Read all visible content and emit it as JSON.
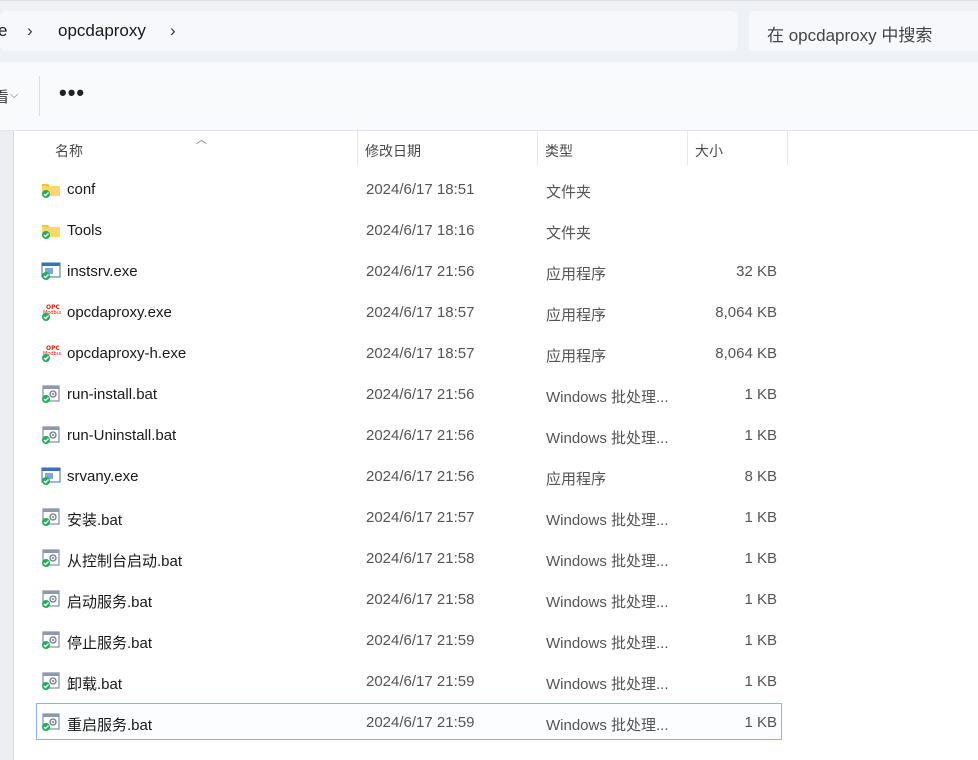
{
  "address": {
    "prev_crumb": "e",
    "separator": "›",
    "current": "opcdaproxy",
    "search_placeholder": "在 opcdaproxy 中搜索"
  },
  "toolbar": {
    "partial_label": "看",
    "more_label": "•••"
  },
  "columns": {
    "name": "名称",
    "date": "修改日期",
    "type": "类型",
    "size": "大小"
  },
  "files": [
    {
      "name": "conf",
      "date": "2024/6/17 18:51",
      "type": "文件夹",
      "size": "",
      "icon": "folder-icon"
    },
    {
      "name": "Tools",
      "date": "2024/6/17 18:16",
      "type": "文件夹",
      "size": "",
      "icon": "folder-icon"
    },
    {
      "name": "instsrv.exe",
      "date": "2024/6/17 21:56",
      "type": "应用程序",
      "size": "32 KB",
      "icon": "app-icon"
    },
    {
      "name": "opcdaproxy.exe",
      "date": "2024/6/17 18:57",
      "type": "应用程序",
      "size": "8,064 KB",
      "icon": "opc-app-icon"
    },
    {
      "name": "opcdaproxy-h.exe",
      "date": "2024/6/17 18:57",
      "type": "应用程序",
      "size": "8,064 KB",
      "icon": "opc-app-icon"
    },
    {
      "name": "run-install.bat",
      "date": "2024/6/17 21:56",
      "type": "Windows 批处理...",
      "size": "1 KB",
      "icon": "batch-file-icon"
    },
    {
      "name": "run-Uninstall.bat",
      "date": "2024/6/17 21:56",
      "type": "Windows 批处理...",
      "size": "1 KB",
      "icon": "batch-file-icon"
    },
    {
      "name": "srvany.exe",
      "date": "2024/6/17 21:56",
      "type": "应用程序",
      "size": "8 KB",
      "icon": "app-icon"
    },
    {
      "name": "安装.bat",
      "date": "2024/6/17 21:57",
      "type": "Windows 批处理...",
      "size": "1 KB",
      "icon": "batch-file-icon"
    },
    {
      "name": "从控制台启动.bat",
      "date": "2024/6/17 21:58",
      "type": "Windows 批处理...",
      "size": "1 KB",
      "icon": "batch-file-icon"
    },
    {
      "name": "启动服务.bat",
      "date": "2024/6/17 21:58",
      "type": "Windows 批处理...",
      "size": "1 KB",
      "icon": "batch-file-icon"
    },
    {
      "name": "停止服务.bat",
      "date": "2024/6/17 21:59",
      "type": "Windows 批处理...",
      "size": "1 KB",
      "icon": "batch-file-icon"
    },
    {
      "name": "卸载.bat",
      "date": "2024/6/17 21:59",
      "type": "Windows 批处理...",
      "size": "1 KB",
      "icon": "batch-file-icon"
    },
    {
      "name": "重启服务.bat",
      "date": "2024/6/17 21:59",
      "type": "Windows 批处理...",
      "size": "1 KB",
      "icon": "batch-file-icon",
      "selected": true
    }
  ],
  "colors": {
    "folder": "#f5c342",
    "sync_badge": "#1fae5b",
    "selection_border": "#8fb3e3"
  }
}
